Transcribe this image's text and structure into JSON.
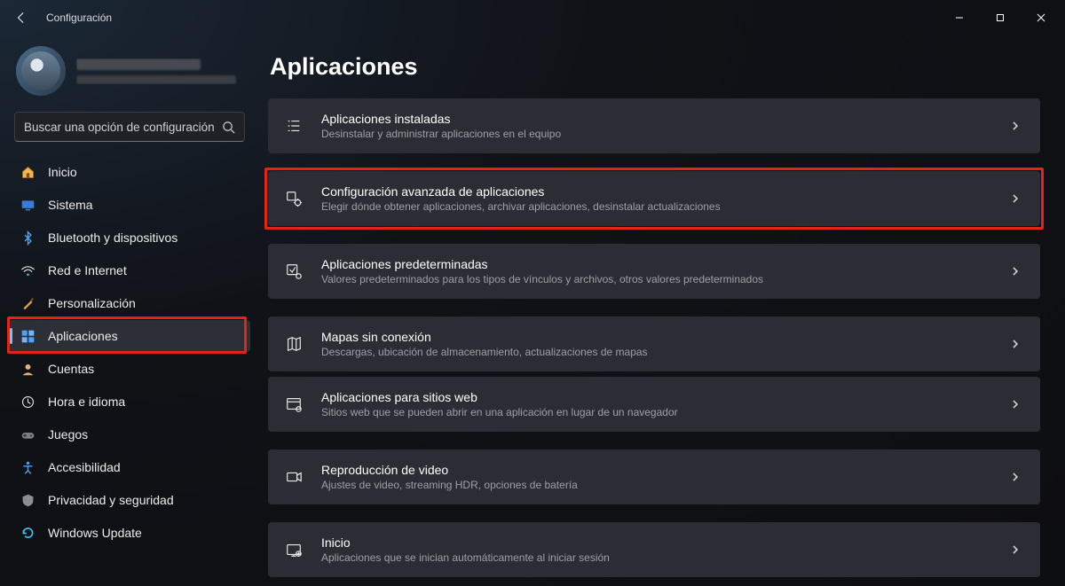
{
  "window": {
    "title": "Configuración"
  },
  "profile": {
    "name_redacted": true,
    "email_redacted": true
  },
  "search": {
    "placeholder": "Buscar una opción de configuración"
  },
  "nav": [
    {
      "id": "home",
      "label": "Inicio",
      "icon": "home"
    },
    {
      "id": "system",
      "label": "Sistema",
      "icon": "system"
    },
    {
      "id": "bt",
      "label": "Bluetooth y dispositivos",
      "icon": "bt"
    },
    {
      "id": "net",
      "label": "Red e Internet",
      "icon": "wifi"
    },
    {
      "id": "pers",
      "label": "Personalización",
      "icon": "brush"
    },
    {
      "id": "apps",
      "label": "Aplicaciones",
      "icon": "apps",
      "active": true,
      "highlight": true
    },
    {
      "id": "acc",
      "label": "Cuentas",
      "icon": "user"
    },
    {
      "id": "time",
      "label": "Hora e idioma",
      "icon": "clock"
    },
    {
      "id": "game",
      "label": "Juegos",
      "icon": "game"
    },
    {
      "id": "a11y",
      "label": "Accesibilidad",
      "icon": "a11y"
    },
    {
      "id": "priv",
      "label": "Privacidad y seguridad",
      "icon": "shield"
    },
    {
      "id": "wu",
      "label": "Windows Update",
      "icon": "update"
    }
  ],
  "page": {
    "title": "Aplicaciones",
    "cards": [
      {
        "id": "installed",
        "title": "Aplicaciones instaladas",
        "sub": "Desinstalar y administrar aplicaciones en el equipo",
        "icon": "list"
      },
      {
        "id": "advanced",
        "title": "Configuración avanzada de aplicaciones",
        "sub": "Elegir dónde obtener aplicaciones, archivar aplicaciones, desinstalar actualizaciones",
        "icon": "gear",
        "group_start": true,
        "highlight": true
      },
      {
        "id": "defaults",
        "title": "Aplicaciones predeterminadas",
        "sub": "Valores predeterminados para los tipos de vínculos y archivos, otros valores predeterminados",
        "icon": "check",
        "group_start": true
      },
      {
        "id": "maps",
        "title": "Mapas sin conexión",
        "sub": "Descargas, ubicación de almacenamiento, actualizaciones de mapas",
        "icon": "map",
        "group_start": true
      },
      {
        "id": "websites",
        "title": "Aplicaciones para sitios web",
        "sub": "Sitios web que se pueden abrir en una aplicación en lugar de un navegador",
        "icon": "globe"
      },
      {
        "id": "video",
        "title": "Reproducción de video",
        "sub": "Ajustes de video, streaming HDR, opciones de batería",
        "icon": "video",
        "group_start": true
      },
      {
        "id": "startup",
        "title": "Inicio",
        "sub": "Aplicaciones que se inician automáticamente al iniciar sesión",
        "icon": "startup",
        "group_start": true
      }
    ]
  }
}
